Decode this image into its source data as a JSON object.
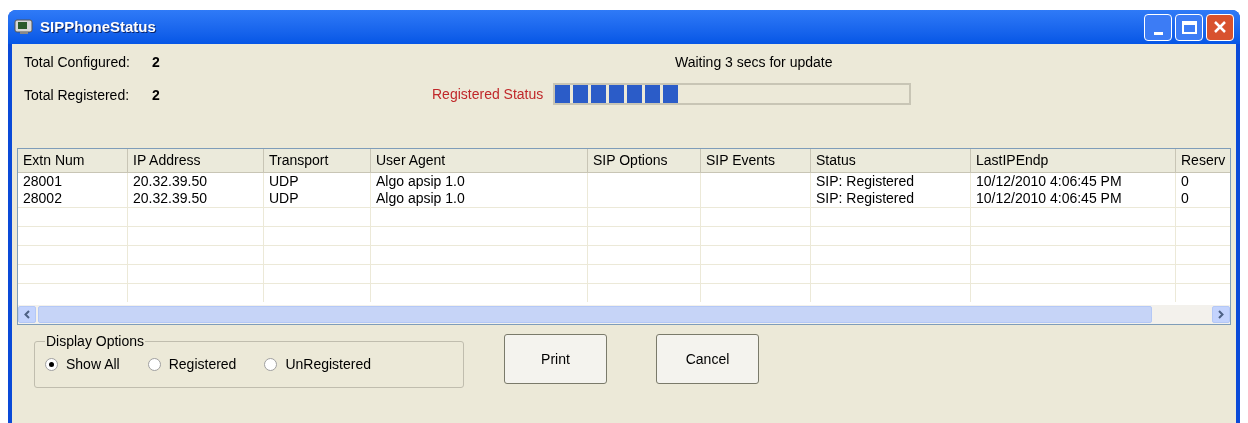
{
  "window": {
    "title": "SIPPhoneStatus"
  },
  "summary": [
    {
      "label": "Total Configured:",
      "value": "2"
    },
    {
      "label": "Total Registered:",
      "value": "2"
    }
  ],
  "update_message": "Waiting 3 secs for update",
  "progress": {
    "label": "Registered Status",
    "level": 0.35
  },
  "table": {
    "columns": [
      "Extn Num",
      "IP Address",
      "Transport",
      "User Agent",
      "SIP Options",
      "SIP Events",
      "Status",
      "LastIPEndp",
      "Reserv"
    ],
    "rows": [
      [
        "28001",
        "20.32.39.50",
        "UDP",
        "Algo apsip 1.0",
        "",
        "",
        "SIP: Registered",
        "10/12/2010 4:06:45 PM",
        "0"
      ],
      [
        "28002",
        "20.32.39.50",
        "UDP",
        "Algo apsip 1.0",
        "",
        "",
        "SIP: Registered",
        "10/12/2010 4:06:45 PM",
        "0"
      ]
    ]
  },
  "display_options": {
    "title": "Display Options",
    "options": [
      {
        "label": "Show All",
        "selected": true
      },
      {
        "label": "Registered",
        "selected": false
      },
      {
        "label": "UnRegistered",
        "selected": false
      }
    ]
  },
  "buttons": [
    "Print",
    "Cancel"
  ]
}
